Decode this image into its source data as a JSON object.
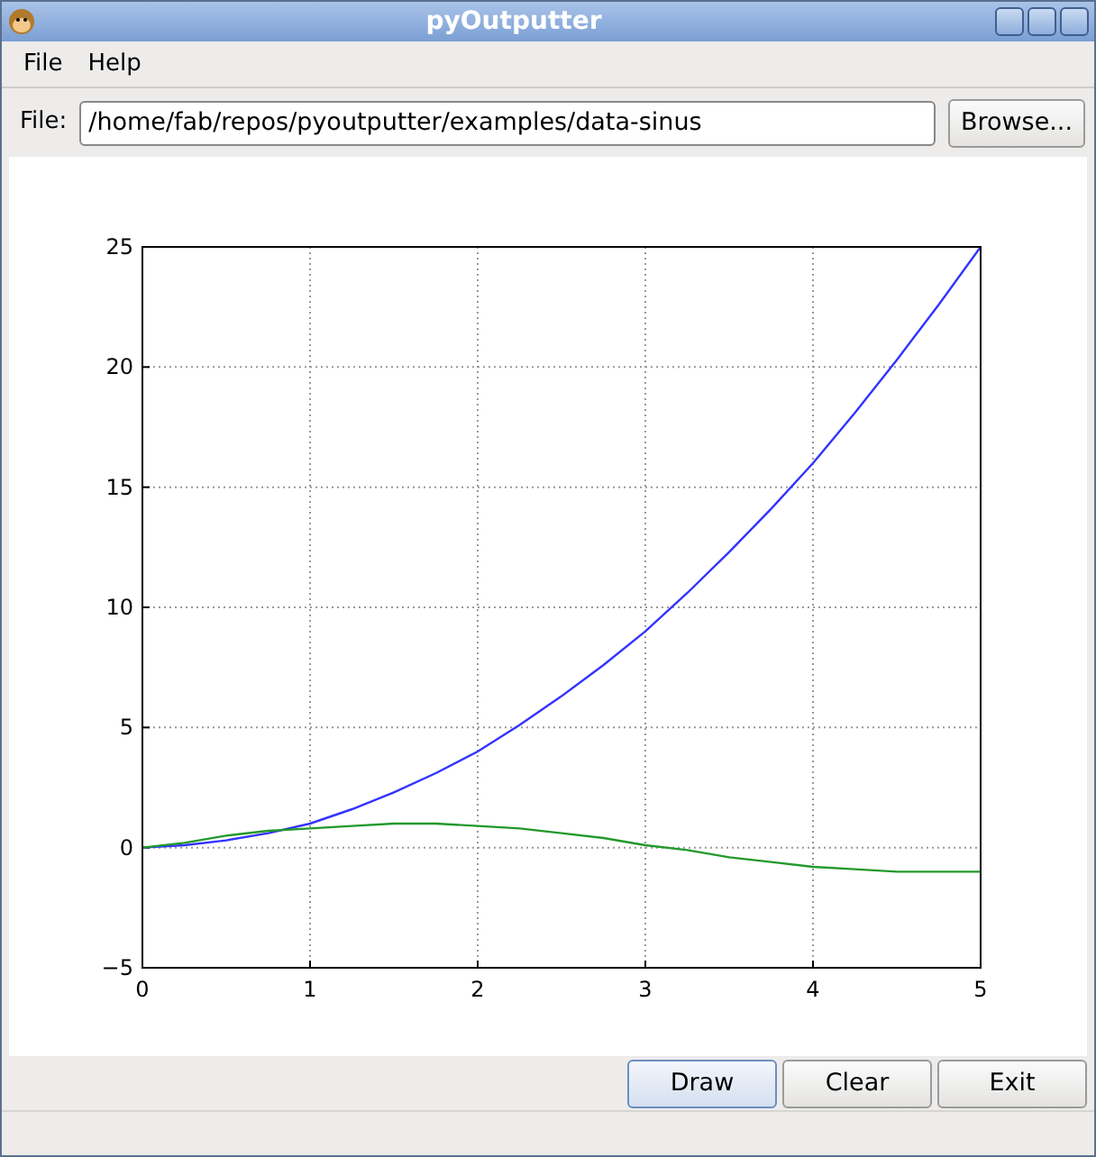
{
  "window": {
    "title": "pyOutputter"
  },
  "menu": [
    {
      "label": "File"
    },
    {
      "label": "Help"
    }
  ],
  "file_row": {
    "label": "File:",
    "value": "/home/fab/repos/pyoutputter/examples/data-sinus",
    "browse": "Browse..."
  },
  "chart": {
    "chart_data": {
      "type": "line",
      "x": [
        0,
        0.25,
        0.5,
        0.75,
        1,
        1.25,
        1.5,
        1.75,
        2,
        2.25,
        2.5,
        2.75,
        3,
        3.25,
        3.5,
        3.75,
        4,
        4.25,
        4.5,
        4.75,
        5
      ],
      "series": [
        {
          "color": "#3333ff",
          "values": [
            0,
            0.1,
            0.3,
            0.6,
            1,
            1.6,
            2.3,
            3.1,
            4,
            5.1,
            6.3,
            7.6,
            9,
            10.6,
            12.3,
            14.1,
            16,
            18.1,
            20.3,
            22.6,
            25
          ]
        },
        {
          "color": "#22992b",
          "values": [
            0,
            0.2,
            0.5,
            0.7,
            0.8,
            0.9,
            1,
            1,
            0.9,
            0.8,
            0.6,
            0.4,
            0.1,
            -0.1,
            -0.4,
            -0.6,
            -0.8,
            -0.9,
            -1,
            -1,
            -1
          ]
        }
      ],
      "grid": true,
      "xlim": [
        0,
        5
      ],
      "ylim": [
        -5,
        25
      ],
      "xticks": [
        0,
        1,
        2,
        3,
        4,
        5
      ],
      "yticks": [
        {
          "value": -5,
          "label": "−5"
        },
        0,
        5,
        10,
        15,
        20,
        25
      ]
    }
  },
  "buttons": [
    {
      "label": "Draw",
      "selected": true
    },
    {
      "label": "Clear",
      "selected": false
    },
    {
      "label": "Exit",
      "selected": false
    }
  ]
}
